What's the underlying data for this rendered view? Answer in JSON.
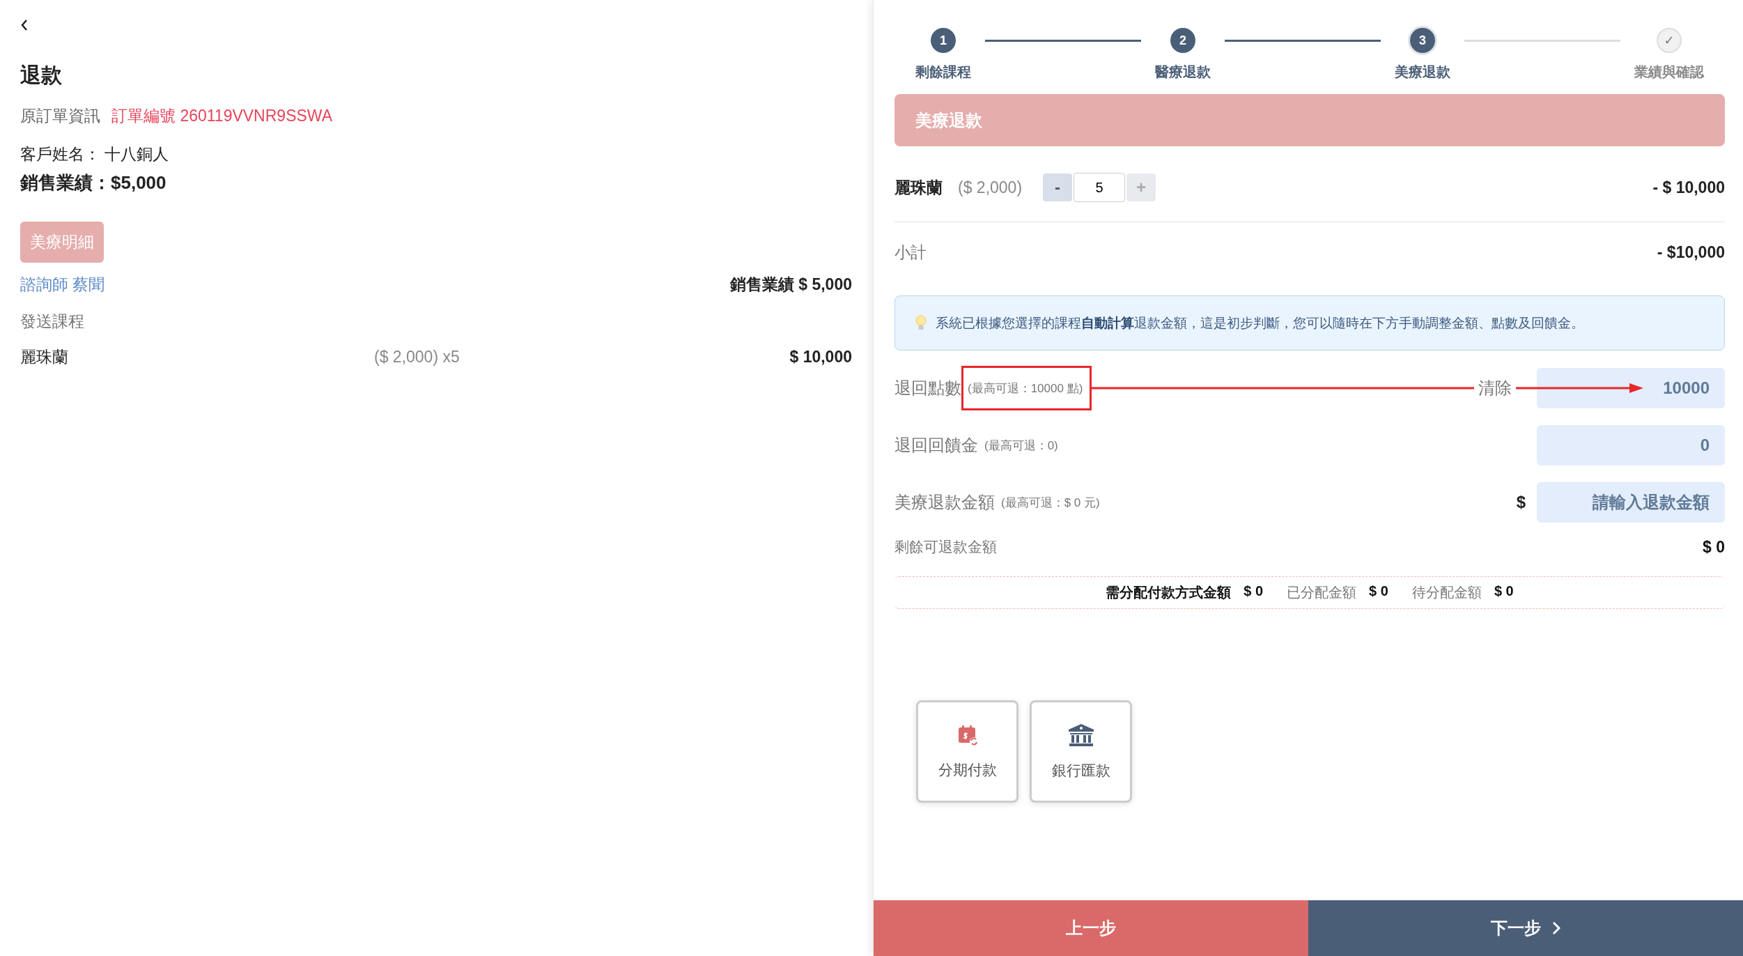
{
  "left": {
    "title": "退款",
    "order_label": "原訂單資訊",
    "order_number": "訂單編號 260119VVNR9SSWA",
    "customer": "客戶姓名： 十八銅人",
    "sales": "銷售業績：$5,000",
    "detail_tab": "美療明細",
    "consultant": "諮詢師 蔡聞",
    "consultant_sales": "銷售業績 $ 5,000",
    "section": "發送課程",
    "items": [
      {
        "name": "麗珠蘭",
        "unit": "($ 2,000) x5",
        "amount": "$ 10,000"
      }
    ]
  },
  "stepper": [
    {
      "marker": "1",
      "label": "剩餘課程",
      "completed": true,
      "selected": false
    },
    {
      "marker": "2",
      "label": "醫療退款",
      "completed": true,
      "selected": false
    },
    {
      "marker": "3",
      "label": "美療退款",
      "completed": false,
      "selected": true
    },
    {
      "marker": "✓",
      "label": "業績與確認",
      "completed": false,
      "selected": false
    }
  ],
  "section_header": "美療退款",
  "refund_items": [
    {
      "name": "麗珠蘭",
      "price": "($ 2,000)",
      "minus": "-",
      "quantity": "5",
      "plus": "+",
      "plus_disabled": true,
      "amount": "- $ 10,000"
    }
  ],
  "subtotal": {
    "label": "小計",
    "value": "- $10,000"
  },
  "notice": "系統已根據您選擇的課程**自動計算**退款金額，這是初步判斷，您可以隨時在下方手動調整金額、點數及回饋金。",
  "fields": [
    {
      "label": "退回點數",
      "hint": "(最高可退：10000 點)",
      "highlighted": true,
      "action": "清除",
      "value": "10000"
    },
    {
      "label": "退回回饋金",
      "hint": "(最高可退：0)",
      "highlighted": false,
      "value": "0"
    },
    {
      "label": "美療退款金額",
      "hint": "(最高可退：$ 0 元)",
      "highlighted": false,
      "prefix": "$",
      "placeholder": "請輸入退款金額"
    }
  ],
  "remaining": {
    "label": "剩餘可退款金額",
    "value": "$ 0"
  },
  "allocation": [
    {
      "label": "需分配付款方式金額",
      "value": "$ 0",
      "emphasis": true
    },
    {
      "label": "已分配金額",
      "value": "$ 0",
      "emphasis": false
    },
    {
      "label": "待分配金額",
      "value": "$ 0",
      "emphasis": false
    }
  ],
  "payment_methods": [
    {
      "label": "分期付款",
      "kind": "installment"
    },
    {
      "label": "銀行匯款",
      "kind": "bank"
    }
  ],
  "footer": {
    "back": "上一步",
    "next": "下一步"
  }
}
